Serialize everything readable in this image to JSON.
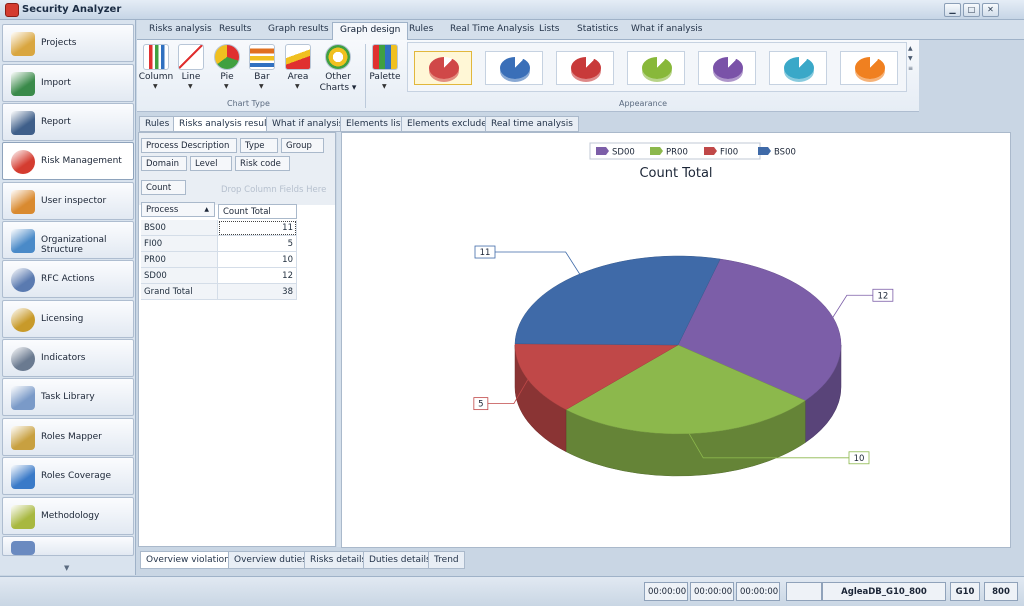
{
  "app": {
    "title": "Security Analyzer"
  },
  "window": {
    "minimize": "▁",
    "restore": "□",
    "close": "✕"
  },
  "sidebar": {
    "items": [
      {
        "label": "Projects",
        "icon": "projects-icon",
        "color": "#d9a640"
      },
      {
        "label": "Import",
        "icon": "import-icon",
        "color": "#3a8a4a"
      },
      {
        "label": "Report",
        "icon": "report-icon",
        "color": "#3f5f8a"
      },
      {
        "label": "Risk Management",
        "icon": "risk-management-icon",
        "color": "#d43c30"
      },
      {
        "label": "User inspector",
        "icon": "user-inspector-icon",
        "color": "#d98a30"
      },
      {
        "label": "Organizational Structure",
        "icon": "org-structure-icon",
        "color": "#4a8ac8"
      },
      {
        "label": "RFC Actions",
        "icon": "rfc-actions-icon",
        "color": "#5a7ab0"
      },
      {
        "label": "Licensing",
        "icon": "licensing-icon",
        "color": "#c89a2a"
      },
      {
        "label": "Indicators",
        "icon": "indicators-icon",
        "color": "#6a7a90"
      },
      {
        "label": "Task Library",
        "icon": "task-library-icon",
        "color": "#7a9ac8"
      },
      {
        "label": "Roles Mapper",
        "icon": "roles-mapper-icon",
        "color": "#c8a040"
      },
      {
        "label": "Roles Coverage",
        "icon": "roles-coverage-icon",
        "color": "#3a7ac8"
      },
      {
        "label": "Methodology",
        "icon": "methodology-icon",
        "color": "#a8b840"
      }
    ],
    "scroll_down": "▼"
  },
  "ribbon_tabs": [
    {
      "label": "Risks analysis"
    },
    {
      "label": "Results"
    },
    {
      "label": "Graph results"
    },
    {
      "label": "Graph design"
    },
    {
      "label": "Rules"
    },
    {
      "label": "Real Time Analysis"
    },
    {
      "label": "Lists"
    },
    {
      "label": "Statistics"
    },
    {
      "label": "What if analysis"
    }
  ],
  "ribbon": {
    "chart_type_caption": "Chart Type",
    "appearance_caption": "Appearance",
    "buttons": [
      {
        "label": "Column",
        "icon": "column-chart-icon"
      },
      {
        "label": "Line",
        "icon": "line-chart-icon"
      },
      {
        "label": "Pie",
        "icon": "pie-chart-icon"
      },
      {
        "label": "Bar",
        "icon": "bar-chart-icon"
      },
      {
        "label": "Area",
        "icon": "area-chart-icon"
      },
      {
        "label": "Other",
        "label2": "Charts ▾",
        "icon": "other-charts-icon"
      }
    ],
    "palette_label": "Palette",
    "palette_icon": "palette-icon",
    "gallery_colors": [
      "#d04848",
      "#3a6fb8",
      "#c83a3a",
      "#88b83a",
      "#7a52a8",
      "#3aa8c8",
      "#f08020"
    ]
  },
  "sub_tabs": [
    {
      "label": "Rules"
    },
    {
      "label": "Risks analysis results"
    },
    {
      "label": "What if analysis"
    },
    {
      "label": "Elements list"
    },
    {
      "label": "Elements excluded"
    },
    {
      "label": "Real time analysis"
    }
  ],
  "pivot": {
    "filter_fields": [
      "Process Description",
      "Type",
      "Group",
      "Domain",
      "Level",
      "Risk code"
    ],
    "data_field": "Count",
    "drop_hint": "Drop Column Fields Here",
    "row_header": "Process",
    "value_header": "Count Total",
    "rows": [
      {
        "label": "BS00",
        "value": "11"
      },
      {
        "label": "FI00",
        "value": "5"
      },
      {
        "label": "PR00",
        "value": "10"
      },
      {
        "label": "SD00",
        "value": "12"
      },
      {
        "label": "Grand Total",
        "value": "38"
      }
    ]
  },
  "chart_data": {
    "type": "pie",
    "title": "Count Total",
    "categories": [
      "SD00",
      "PR00",
      "FI00",
      "BS00"
    ],
    "values": [
      12,
      10,
      5,
      11
    ],
    "colors": [
      "#7c5ea8",
      "#8cb84c",
      "#c04848",
      "#3f6aa8"
    ],
    "legend": "top-center"
  },
  "bottom_tabs": [
    {
      "label": "Overview violations"
    },
    {
      "label": "Overview duties"
    },
    {
      "label": "Risks details"
    },
    {
      "label": "Duties details"
    },
    {
      "label": "Trend"
    }
  ],
  "status": {
    "timer1": "00:00:00",
    "timer2": "00:00:00",
    "timer3": "00:00:00",
    "db": "AgleaDB_G10_800",
    "system": "G10",
    "client": "800"
  }
}
